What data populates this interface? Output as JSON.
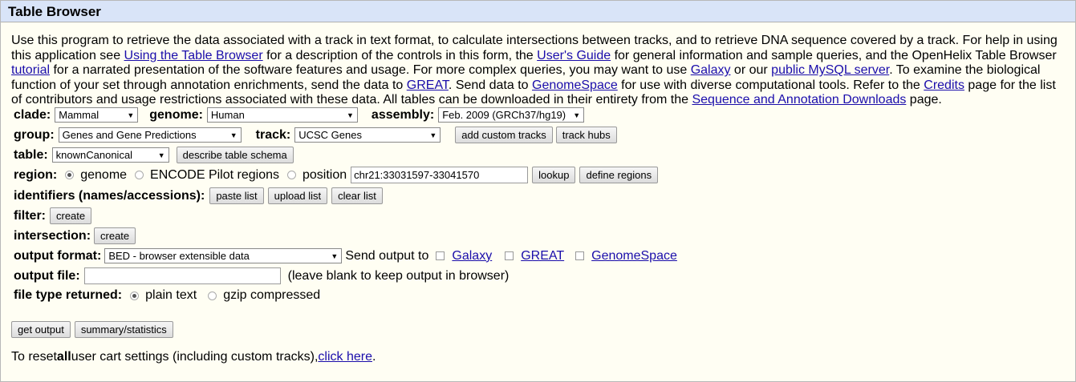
{
  "title": "Table Browser",
  "intro": {
    "t1": "Use this program to retrieve the data associated with a track in text format, to calculate intersections between tracks, and to retrieve DNA sequence covered by a track. For help in using this application see ",
    "l1": "Using the Table Browser",
    "t2": " for a description of the controls in this form, the ",
    "l2": "User's Guide",
    "t3": " for general information and sample queries, and the OpenHelix Table Browser ",
    "l3": "tutorial",
    "t4": " for a narrated presentation of the software features and usage. For more complex queries, you may want to use ",
    "l4": "Galaxy",
    "t5": " or our ",
    "l5": "public MySQL server",
    "t6": ". To examine the biological function of your set through annotation enrichments, send the data to ",
    "l6": "GREAT",
    "t7": ". Send data to ",
    "l7": "GenomeSpace",
    "t8": " for use with diverse computational tools. Refer to the ",
    "l8": "Credits",
    "t9": " page for the list of contributors and usage restrictions associated with these data. All tables can be downloaded in their entirety from the ",
    "l9": "Sequence and Annotation Downloads",
    "t10": " page."
  },
  "form": {
    "clade_label": "clade:",
    "clade_value": "Mammal",
    "genome_label": "genome:",
    "genome_value": "Human",
    "assembly_label": "assembly:",
    "assembly_value": "Feb. 2009 (GRCh37/hg19)",
    "group_label": "group:",
    "group_value": "Genes and Gene Predictions",
    "track_label": "track:",
    "track_value": "UCSC Genes",
    "add_custom_tracks": "add custom tracks",
    "track_hubs": "track hubs",
    "table_label": "table:",
    "table_value": "knownCanonical",
    "describe_schema": "describe table schema",
    "region_label": "region:",
    "region_genome": "genome",
    "region_encode": "ENCODE Pilot regions",
    "region_position": "position",
    "position_value": "chr21:33031597-33041570",
    "lookup": "lookup",
    "define_regions": "define regions",
    "identifiers_label": "identifiers (names/accessions):",
    "paste_list": "paste list",
    "upload_list": "upload list",
    "clear_list": "clear list",
    "filter_label": "filter:",
    "filter_create": "create",
    "intersection_label": "intersection:",
    "intersection_create": "create",
    "output_format_label": "output format:",
    "output_format_value": "BED - browser extensible data",
    "send_output_to": "Send output to",
    "send_galaxy": "Galaxy",
    "send_great": "GREAT",
    "send_genomespace": "GenomeSpace",
    "output_file_label": "output file:",
    "output_file_value": "",
    "output_file_hint": "(leave blank to keep output in browser)",
    "file_type_label": "file type returned:",
    "plain_text": "plain text",
    "gzip": "gzip compressed",
    "get_output": "get output",
    "summary": "summary/statistics"
  },
  "reset": {
    "t1": "To reset ",
    "bold": "all",
    "t2": " user cart settings (including custom tracks), ",
    "link": "click here",
    "t3": "."
  }
}
